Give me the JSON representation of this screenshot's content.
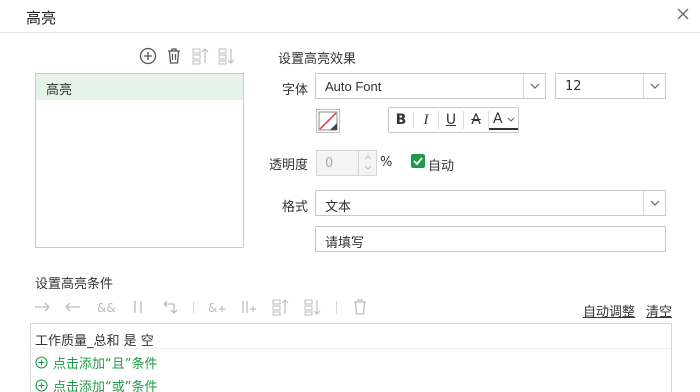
{
  "window": {
    "title": "高亮"
  },
  "highlight_list": {
    "items": [
      {
        "label": "高亮"
      }
    ]
  },
  "effects": {
    "section_title": "设置高亮效果",
    "font_label": "字体",
    "font_value": "Auto Font",
    "size_value": "12",
    "format_buttons": {
      "bold": "B",
      "italic": "I",
      "underline": "U",
      "strike": "A",
      "fontcolor": "A"
    },
    "transparency_label": "透明度",
    "transparency_value": "0",
    "percent": "%",
    "auto_label": "自动",
    "auto_checked": true,
    "format_label": "格式",
    "format_value": "文本",
    "format_placeholder": "请填写"
  },
  "conditions": {
    "section_title": "设置高亮条件",
    "auto_adjust": "自动调整",
    "clear": "清空",
    "rows": [
      {
        "text": "工作质量_总和 是 空"
      },
      {
        "text": "点击添加“且”条件"
      },
      {
        "text": "点击添加“或”条件"
      }
    ]
  },
  "colors": {
    "accent": "#1e9a4a",
    "selected_bg": "#e6f3e8",
    "border": "#c9c9c9",
    "disabled_icon": "#bdbdbd"
  }
}
